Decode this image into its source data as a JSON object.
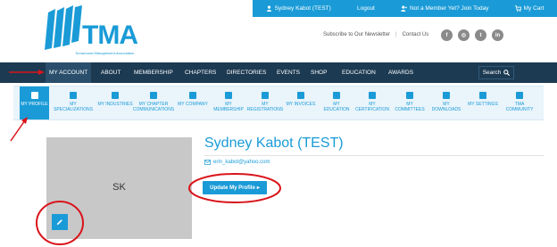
{
  "topbar": {
    "user": "Sydney Kabot (TEST)",
    "logout": "Logout",
    "join": "Not a Member Yet? Join Today",
    "cart": "My Cart"
  },
  "logo": {
    "brand": "TMA",
    "tagline": "Turnaround Management Association"
  },
  "utility": {
    "subscribe": "Subscribe to Our Newsletter",
    "contact": "Contact Us"
  },
  "socials": [
    "facebook-icon",
    "instagram-icon",
    "twitter-icon",
    "linkedin-icon"
  ],
  "social_glyphs": [
    "f",
    "◎",
    "t",
    "in"
  ],
  "mainnav": {
    "items": [
      "MY ACCOUNT",
      "ABOUT",
      "MEMBERSHIP",
      "CHAPTERS",
      "DIRECTORIES",
      "EVENTS",
      "SHOP",
      "EDUCATION",
      "AWARDS"
    ],
    "search": "Search"
  },
  "subnav": [
    "MY PROFILE",
    "MY\nSPECIALIZATIONS",
    "MY INDUSTRIES",
    "MY CHAPTER\nCOMMUNICATIONS",
    "MY COMPANY",
    "MY\nMEMBERSHIP",
    "MY\nREGISTRATIONS",
    "MY INVOICES",
    "MY\nEDUCATION",
    "MY\nCERTIFICATION",
    "MY\nCOMMITTEES",
    "MY\nDOWNLOADS",
    "MY SETTINGS",
    "TMA\nCOMMUNITY"
  ],
  "profile": {
    "initials": "SK",
    "name": "Sydney Kabot (TEST)",
    "email": "erin_kabot@yahoo.com",
    "update_label": "Update My Profile"
  },
  "colors": {
    "brand": "#1a9bd7",
    "nav": "#1c3a52",
    "annotation": "#d9141b"
  }
}
